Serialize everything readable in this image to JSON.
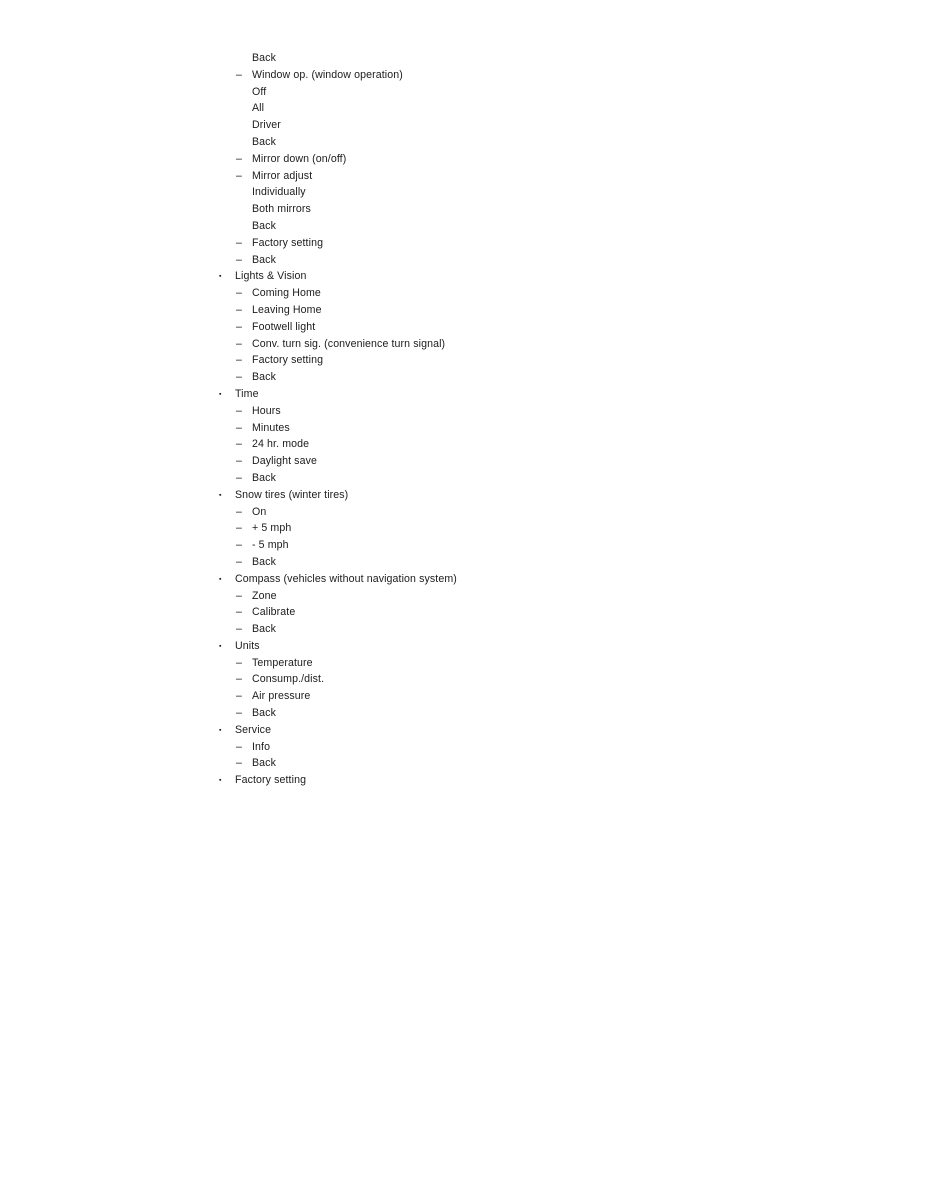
{
  "document": {
    "type": "nested-outline",
    "markers": {
      "level1": "▪",
      "level2": "–",
      "level3": ""
    },
    "text_color": "#1c1c1c",
    "background_color": "#ffffff",
    "items": [
      {
        "level": 3,
        "label": "Back"
      },
      {
        "level": 2,
        "label": "Window op. (window operation)"
      },
      {
        "level": 3,
        "label": "Off"
      },
      {
        "level": 3,
        "label": "All"
      },
      {
        "level": 3,
        "label": "Driver"
      },
      {
        "level": 3,
        "label": "Back"
      },
      {
        "level": 2,
        "label": "Mirror down (on/off)"
      },
      {
        "level": 2,
        "label": "Mirror adjust"
      },
      {
        "level": 3,
        "label": "Individually"
      },
      {
        "level": 3,
        "label": "Both mirrors"
      },
      {
        "level": 3,
        "label": "Back"
      },
      {
        "level": 2,
        "label": "Factory setting"
      },
      {
        "level": 2,
        "label": "Back"
      },
      {
        "level": 1,
        "label": "Lights & Vision"
      },
      {
        "level": 2,
        "label": "Coming Home"
      },
      {
        "level": 2,
        "label": "Leaving Home"
      },
      {
        "level": 2,
        "label": "Footwell light"
      },
      {
        "level": 2,
        "label": "Conv. turn sig. (convenience turn signal)"
      },
      {
        "level": 2,
        "label": "Factory setting"
      },
      {
        "level": 2,
        "label": "Back"
      },
      {
        "level": 1,
        "label": "Time"
      },
      {
        "level": 2,
        "label": "Hours"
      },
      {
        "level": 2,
        "label": "Minutes"
      },
      {
        "level": 2,
        "label": "24 hr. mode"
      },
      {
        "level": 2,
        "label": "Daylight save"
      },
      {
        "level": 2,
        "label": "Back"
      },
      {
        "level": 1,
        "label": "Snow tires (winter tires)"
      },
      {
        "level": 2,
        "label": "On"
      },
      {
        "level": 2,
        "label": "+ 5 mph"
      },
      {
        "level": 2,
        "label": "- 5 mph"
      },
      {
        "level": 2,
        "label": "Back"
      },
      {
        "level": 1,
        "label": "Compass (vehicles without navigation system)"
      },
      {
        "level": 2,
        "label": "Zone"
      },
      {
        "level": 2,
        "label": "Calibrate"
      },
      {
        "level": 2,
        "label": "Back"
      },
      {
        "level": 1,
        "label": "Units"
      },
      {
        "level": 2,
        "label": "Temperature"
      },
      {
        "level": 2,
        "label": "Consump./dist."
      },
      {
        "level": 2,
        "label": "Air pressure"
      },
      {
        "level": 2,
        "label": "Back"
      },
      {
        "level": 1,
        "label": "Service"
      },
      {
        "level": 2,
        "label": "Info"
      },
      {
        "level": 2,
        "label": "Back"
      },
      {
        "level": 1,
        "label": "Factory setting"
      }
    ]
  }
}
